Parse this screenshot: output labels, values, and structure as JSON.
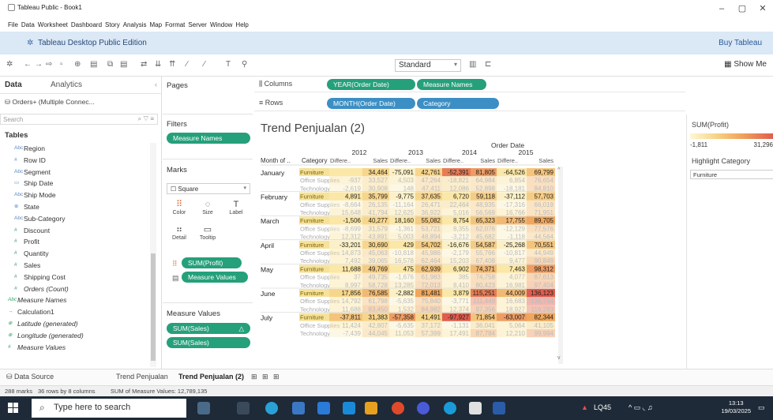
{
  "window": {
    "title": "Tableau Public - Book1",
    "controls": [
      "–",
      "▢",
      "✕"
    ]
  },
  "menu": [
    "File",
    "Data",
    "Worksheet",
    "Dashboard",
    "Story",
    "Analysis",
    "Map",
    "Format",
    "Server",
    "Window",
    "Help"
  ],
  "edition": {
    "label": "Tableau Desktop Public Edition",
    "buy": "Buy Tableau"
  },
  "toolbar": {
    "fit": "Standard",
    "show_me": "Show Me"
  },
  "data_pane": {
    "tab_data": "Data",
    "tab_analytics": "Analytics",
    "datasource": "Orders+ (Multiple Connec...",
    "search_placeholder": "Search",
    "tables_label": "Tables",
    "fields": [
      {
        "icon": "Abc",
        "name": "Region",
        "type": "dim"
      },
      {
        "icon": "#",
        "name": "Row ID",
        "type": "dim"
      },
      {
        "icon": "Abc",
        "name": "Segment",
        "type": "dim"
      },
      {
        "icon": "▭",
        "name": "Ship Date",
        "type": "dim"
      },
      {
        "icon": "Abc",
        "name": "Ship Mode",
        "type": "dim"
      },
      {
        "icon": "⊕",
        "name": "State",
        "type": "dim"
      },
      {
        "icon": "Abc",
        "name": "Sub-Category",
        "type": "dim"
      },
      {
        "icon": "#",
        "name": "Discount",
        "type": "meas"
      },
      {
        "icon": "#",
        "name": "Profit",
        "type": "meas"
      },
      {
        "icon": "#",
        "name": "Quantity",
        "type": "meas"
      },
      {
        "icon": "#",
        "name": "Sales",
        "type": "meas"
      },
      {
        "icon": "#",
        "name": "Shipping Cost",
        "type": "meas"
      },
      {
        "icon": "#",
        "name": "Orders (Count)",
        "type": "meas",
        "italic": true
      },
      {
        "icon": "Abc",
        "name": "Measure Names",
        "type": "sep",
        "italic": true
      },
      {
        "icon": "→",
        "name": "Calculation1",
        "type": "sep"
      },
      {
        "icon": "⊕",
        "name": "Latitude (generated)",
        "type": "sep",
        "italic": true
      },
      {
        "icon": "⊕",
        "name": "Longitude (generated)",
        "type": "sep",
        "italic": true
      },
      {
        "icon": "#",
        "name": "Measure Values",
        "type": "sep",
        "italic": true
      }
    ]
  },
  "cards": {
    "pages": "Pages",
    "filters": "Filters",
    "filter_pill": "Measure Names",
    "marks": "Marks",
    "mark_type": "Square",
    "mark_buttons": [
      {
        "glyph": "⠿",
        "label": "Color"
      },
      {
        "glyph": "◌",
        "label": "Size"
      },
      {
        "glyph": "T",
        "label": "Label"
      },
      {
        "glyph": "⠶",
        "label": "Detail"
      },
      {
        "glyph": "▭",
        "label": "Tooltip"
      }
    ],
    "color_pill": "SUM(Profit)",
    "text_pill": "Measure Values",
    "measure_values": "Measure Values",
    "mv_pills": [
      "SUM(Sales)",
      "SUM(Sales)"
    ]
  },
  "shelves": {
    "columns_label": "Columns",
    "rows_label": "Rows",
    "columns": [
      "YEAR(Order Date)",
      "Measure Names"
    ],
    "rows": [
      "MONTH(Order Date)",
      "Category"
    ]
  },
  "view": {
    "title": "Trend Penjualan (2)",
    "top_header": "Order Date",
    "row_header_month": "Month of ..",
    "row_header_category": "Category",
    "years": [
      "2012",
      "2013",
      "2014",
      "2015"
    ],
    "measures": [
      "Differe..",
      "Sales"
    ]
  },
  "chart_data": {
    "type": "table",
    "title": "Trend Penjualan (2)",
    "columns": [
      "2012 Differe..",
      "2012 Sales",
      "2013 Differe..",
      "2013 Sales",
      "2014 Differe..",
      "2014 Sales",
      "2015 Differe..",
      "2015 Sales"
    ],
    "rows": [
      {
        "month": "January",
        "category": "Furniture",
        "values": [
          "",
          "34,464",
          "-75,091",
          "42,761",
          "-52,391",
          "81,805",
          "-64,526",
          "69,799"
        ],
        "colors": [
          "#fbe7a6",
          "#f7d68c",
          "#fbf0c6",
          "#f7d68c",
          "#e87b56",
          "#ee9c62",
          "#fbe7a6",
          "#f4c47c"
        ]
      },
      {
        "month": "",
        "category": "Office Supplies",
        "values": [
          "-937",
          "33,527",
          "4,503",
          "47,264",
          "-18,821",
          "64,984",
          "6,854",
          "76,654"
        ],
        "colors": [
          "#fbe7a6",
          "#f7d68c",
          "#fbe7a6",
          "#f5cc84",
          "#f7d68c",
          "#f5cc84",
          "#fbe7a6",
          "#f2b974"
        ]
      },
      {
        "month": "",
        "category": "Technology",
        "values": [
          "-2,619",
          "30,908",
          "148",
          "47,411",
          "12,086",
          "52,898",
          "-18,181",
          "84,810"
        ],
        "colors": [
          "#fbf0c6",
          "#f7d68c",
          "#fbf0c6",
          "#f5cc84",
          "#f7d68c",
          "#f5cc84",
          "#fbf0c6",
          "#f2b974"
        ]
      },
      {
        "month": "February",
        "category": "Furniture",
        "values": [
          "4,891",
          "35,799",
          "-9,775",
          "37,635",
          "6,720",
          "59,118",
          "-37,112",
          "57,703"
        ],
        "colors": [
          "#fbe7a6",
          "#f7d68c",
          "#fbf0c6",
          "#f7d68c",
          "#fbe7a6",
          "#f5cc84",
          "#fbf0c6",
          "#f5cc84"
        ]
      },
      {
        "month": "",
        "category": "Office Supplies",
        "values": [
          "-8,664",
          "26,135",
          "-11,164",
          "26,471",
          "22,464",
          "48,935",
          "-17,316",
          "66,019"
        ],
        "colors": [
          "#fbf0c6",
          "#f7d68c",
          "#fbf0c6",
          "#f7d68c",
          "#f7d68c",
          "#f5cc84",
          "#fbf0c6",
          "#f4c47c"
        ]
      },
      {
        "month": "",
        "category": "Technology",
        "values": [
          "15,648",
          "41,794",
          "12,625",
          "36,922",
          "5,016",
          "56,569",
          "16,766",
          "71,951"
        ],
        "colors": [
          "#fbe7a6",
          "#f7d68c",
          "#fbe7a6",
          "#f7d68c",
          "#fbe7a6",
          "#f5cc84",
          "#fbe7a6",
          "#f4c47c"
        ]
      },
      {
        "month": "March",
        "category": "Furniture",
        "values": [
          "-1,506",
          "40,277",
          "18,160",
          "55,082",
          "8,754",
          "65,323",
          "17,755",
          "89,705"
        ],
        "colors": [
          "#fbe7a6",
          "#f7d68c",
          "#fbe7a6",
          "#f5cc84",
          "#fbe7a6",
          "#f4c47c",
          "#f2b974",
          "#f0a65c"
        ]
      },
      {
        "month": "",
        "category": "Office Supplies",
        "values": [
          "-8,699",
          "31,579",
          "-1,361",
          "53,721",
          "8,355",
          "62,076",
          "-12,129",
          "77,576"
        ],
        "colors": [
          "#fbf0c6",
          "#f7d68c",
          "#fbf0c6",
          "#f5cc84",
          "#fbe7a6",
          "#f4c47c",
          "#fbf0c6",
          "#f2b974"
        ]
      },
      {
        "month": "",
        "category": "Technology",
        "values": [
          "12,312",
          "43,891",
          "5,003",
          "48,894",
          "-3,212",
          "45,682",
          "-1,118",
          "44,564"
        ],
        "colors": [
          "#fbe7a6",
          "#f7d68c",
          "#fbe7a6",
          "#f5cc84",
          "#fbf0c6",
          "#f5cc84",
          "#fbf0c6",
          "#f5cc84"
        ]
      },
      {
        "month": "April",
        "category": "Furniture",
        "values": [
          "-33,201",
          "30,690",
          "429",
          "54,702",
          "-16,676",
          "54,587",
          "-25,268",
          "70,551"
        ],
        "colors": [
          "#fbf0c6",
          "#f7d68c",
          "#fbe7a6",
          "#f5cc84",
          "#fbf0c6",
          "#f5cc84",
          "#fbf0c6",
          "#f4c47c"
        ]
      },
      {
        "month": "",
        "category": "Office Supplies",
        "values": [
          "14,873",
          "45,063",
          "-10,818",
          "45,986",
          "-2,179",
          "55,766",
          "-10,817",
          "44,949"
        ],
        "colors": [
          "#fbe7a6",
          "#f5cc84",
          "#fbf0c6",
          "#f5cc84",
          "#fbf0c6",
          "#f5cc84",
          "#fbf0c6",
          "#f5cc84"
        ]
      },
      {
        "month": "",
        "category": "Technology",
        "values": [
          "7,492",
          "39,065",
          "16,578",
          "62,464",
          "15,203",
          "67,408",
          "9,477",
          "90,849"
        ],
        "colors": [
          "#fbe7a6",
          "#f7d68c",
          "#fbe7a6",
          "#f4c47c",
          "#fbe7a6",
          "#f4c47c",
          "#fbe7a6",
          "#f0a65c"
        ]
      },
      {
        "month": "May",
        "category": "Furniture",
        "values": [
          "11,688",
          "49,769",
          "475",
          "62,939",
          "6,902",
          "74,371",
          "7,463",
          "98,312"
        ],
        "colors": [
          "#fbe7a6",
          "#f5cc84",
          "#fbe7a6",
          "#f4c47c",
          "#fbe7a6",
          "#f2b974",
          "#fbe7a6",
          "#ee9c62"
        ]
      },
      {
        "month": "",
        "category": "Office Supplies",
        "values": [
          "37",
          "49,735",
          "-1,676",
          "61,983",
          "385",
          "74,758",
          "4,077",
          "87,613"
        ],
        "colors": [
          "#fbe7a6",
          "#f5cc84",
          "#fbf0c6",
          "#f4c47c",
          "#fbe7a6",
          "#f2b974",
          "#fbe7a6",
          "#f0a65c"
        ]
      },
      {
        "month": "",
        "category": "Technology",
        "values": [
          "8,997",
          "58,728",
          "13,285",
          "72,013",
          "8,410",
          "80,423",
          "16,981",
          "97,404"
        ],
        "colors": [
          "#fbe7a6",
          "#f5cc84",
          "#fbe7a6",
          "#f2b974",
          "#fbe7a6",
          "#f2b974",
          "#fbe7a6",
          "#ee9c62"
        ]
      },
      {
        "month": "June",
        "category": "Furniture",
        "values": [
          "17,856",
          "76,585",
          "-2,882",
          "81,481",
          "3,879",
          "115,251",
          "44,009",
          "136,123"
        ],
        "colors": [
          "#f7d68c",
          "#f2b974",
          "#fbf0c6",
          "#f0a65c",
          "#fbe7a6",
          "#e87b56",
          "#f2b974",
          "#e05c4e"
        ]
      },
      {
        "month": "",
        "category": "Office Supplies",
        "values": [
          "14,792",
          "61,798",
          "-5,635",
          "75,840",
          "-3,771",
          "111,449",
          "16,683",
          "136,734"
        ],
        "colors": [
          "#fbe7a6",
          "#f4c47c",
          "#fbf0c6",
          "#f2b974",
          "#fbf0c6",
          "#e87b56",
          "#fbe7a6",
          "#e05c4e"
        ]
      },
      {
        "month": "",
        "category": "Technology",
        "values": [
          "11,688",
          "83,450",
          "1,532",
          "84,982",
          "12,374",
          "97,356",
          "18,927",
          "116,283"
        ],
        "colors": [
          "#fbe7a6",
          "#f0a65c",
          "#fbe7a6",
          "#f0a65c",
          "#fbe7a6",
          "#ee9c62",
          "#fbe7a6",
          "#e87b56"
        ]
      },
      {
        "month": "July",
        "category": "Furniture",
        "values": [
          "-37,811",
          "31,383",
          "-57,358",
          "41,491",
          "-97,927",
          "71,854",
          "-63,007",
          "82,344"
        ],
        "colors": [
          "#f4c47c",
          "#f7d68c",
          "#ee9c62",
          "#f7d68c",
          "#e05c4e",
          "#f4c47c",
          "#ee9c62",
          "#f0a65c"
        ]
      },
      {
        "month": "",
        "category": "Office Supplies",
        "values": [
          "11,424",
          "42,807",
          "-5,635",
          "37,172",
          "-1,131",
          "36,041",
          "5,064",
          "41,105"
        ],
        "colors": [
          "#fbe7a6",
          "#f7d68c",
          "#fbf0c6",
          "#f7d68c",
          "#fbf0c6",
          "#f7d68c",
          "#fbe7a6",
          "#f7d68c"
        ]
      },
      {
        "month": "",
        "category": "Technology",
        "values": [
          "-7,439",
          "44,045",
          "11,053",
          "57,399",
          "17,491",
          "87,784",
          "12,210",
          "99,994"
        ],
        "colors": [
          "#fbf0c6",
          "#f5cc84",
          "#fbe7a6",
          "#f5cc84",
          "#fbe7a6",
          "#f0a65c",
          "#fbe7a6",
          "#ee9c62"
        ]
      }
    ]
  },
  "legend": {
    "title": "SUM(Profit)",
    "min": "-1,811",
    "max": "31,296",
    "highlight_title": "Highlight Category",
    "highlight_value": "Furniture"
  },
  "sheets": {
    "datasource": "Data Source",
    "tabs": [
      "Trend Penjualan",
      "Trend Penjualan (2)"
    ],
    "active": "Trend Penjualan (2)"
  },
  "status": {
    "marks": "288 marks",
    "dims": "36 rows by 8 columns",
    "sum": "SUM of Measure Values: 12,789,135"
  },
  "taskbar": {
    "search_placeholder": "Type here to search",
    "weather": "LQ45",
    "time": "13:13",
    "date": "19/03/2025"
  }
}
